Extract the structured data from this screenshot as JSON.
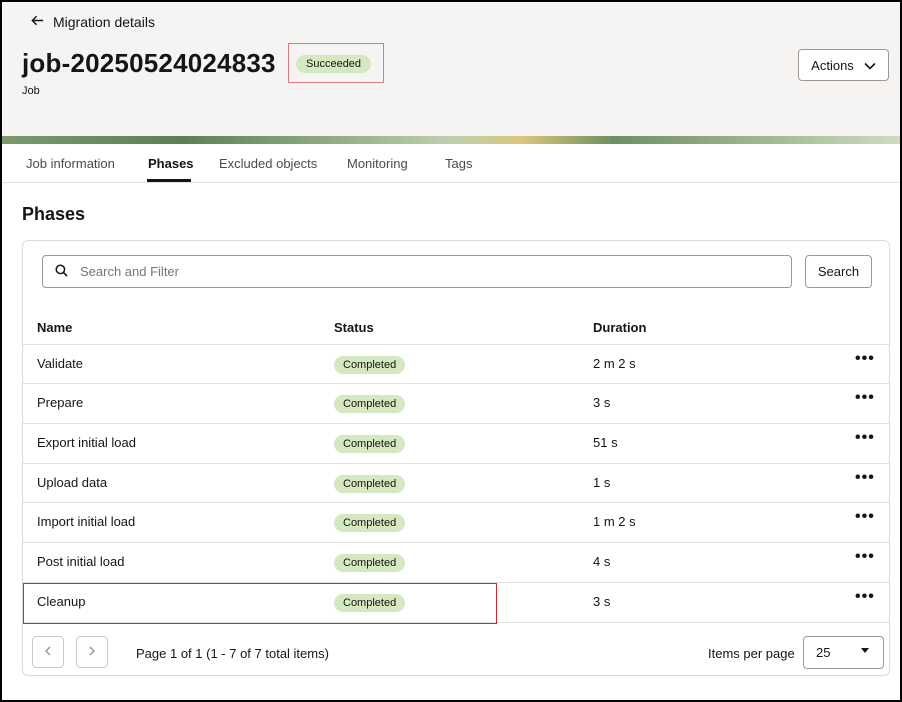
{
  "header": {
    "back_label": "Migration details",
    "title": "job-20250524024833",
    "status_badge": "Succeeded",
    "subtitle": "Job",
    "actions_label": "Actions"
  },
  "tabs": [
    {
      "label": "Job information"
    },
    {
      "label": "Phases"
    },
    {
      "label": "Excluded objects"
    },
    {
      "label": "Monitoring"
    },
    {
      "label": "Tags"
    }
  ],
  "active_tab": "Phases",
  "section_title": "Phases",
  "search": {
    "placeholder": "Search and Filter",
    "button_label": "Search"
  },
  "table": {
    "columns": [
      "Name",
      "Status",
      "Duration"
    ],
    "rows": [
      {
        "name": "Validate",
        "status": "Completed",
        "duration": "2 m 2 s"
      },
      {
        "name": "Prepare",
        "status": "Completed",
        "duration": "3 s"
      },
      {
        "name": "Export initial load",
        "status": "Completed",
        "duration": "51 s"
      },
      {
        "name": "Upload data",
        "status": "Completed",
        "duration": "1 s"
      },
      {
        "name": "Import initial load",
        "status": "Completed",
        "duration": "1 m 2 s"
      },
      {
        "name": "Post initial load",
        "status": "Completed",
        "duration": "4 s"
      },
      {
        "name": "Cleanup",
        "status": "Completed",
        "duration": "3 s"
      }
    ],
    "row_menu_glyph": "•••"
  },
  "pagination": {
    "page_text": "Page 1 of 1 (1 - 7 of 7 total items)",
    "items_per_page_label": "Items per page",
    "items_per_page_value": "25"
  },
  "colors": {
    "badge_bg": "#d4e8c1",
    "highlight": "#d6262e"
  }
}
